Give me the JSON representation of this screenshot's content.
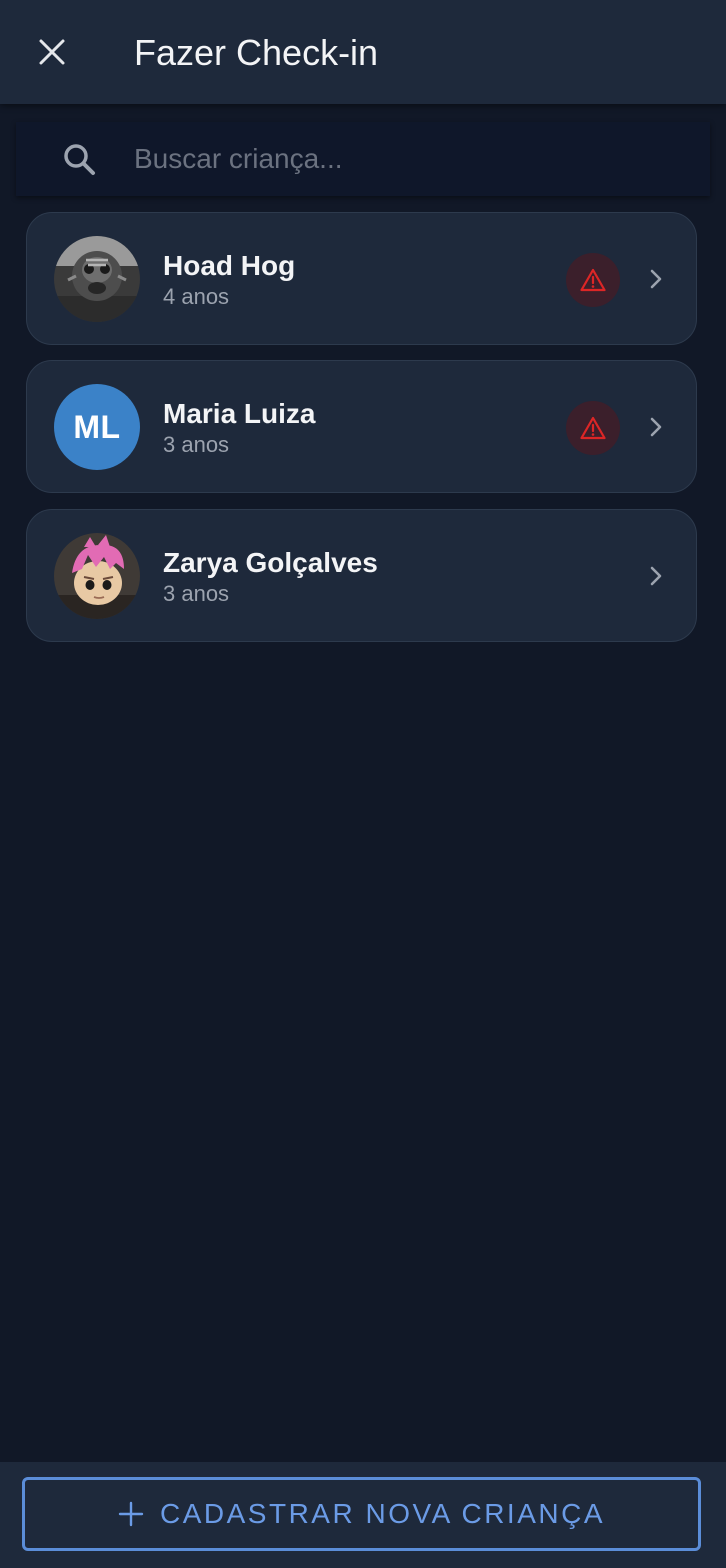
{
  "header": {
    "title": "Fazer Check-in",
    "close_icon": "close-icon"
  },
  "search": {
    "placeholder": "Buscar criança...",
    "value": "",
    "icon": "search-icon"
  },
  "children": [
    {
      "name": "Hoad Hog",
      "age": "4 anos",
      "avatar_type": "photo",
      "has_alert": true
    },
    {
      "name": "Maria Luiza",
      "age": "3 anos",
      "avatar_type": "initials",
      "initials": "ML",
      "has_alert": true
    },
    {
      "name": "Zarya Golçalves",
      "age": "3 anos",
      "avatar_type": "photo",
      "has_alert": false
    }
  ],
  "footer": {
    "add_label": "CADASTRAR NOVA CRIANÇA",
    "add_icon": "plus-icon"
  },
  "colors": {
    "background": "#111827",
    "surface": "#1e293b",
    "accent": "#5b8dd8",
    "alert": "#dc2626",
    "initials_avatar": "#3b82c8"
  }
}
